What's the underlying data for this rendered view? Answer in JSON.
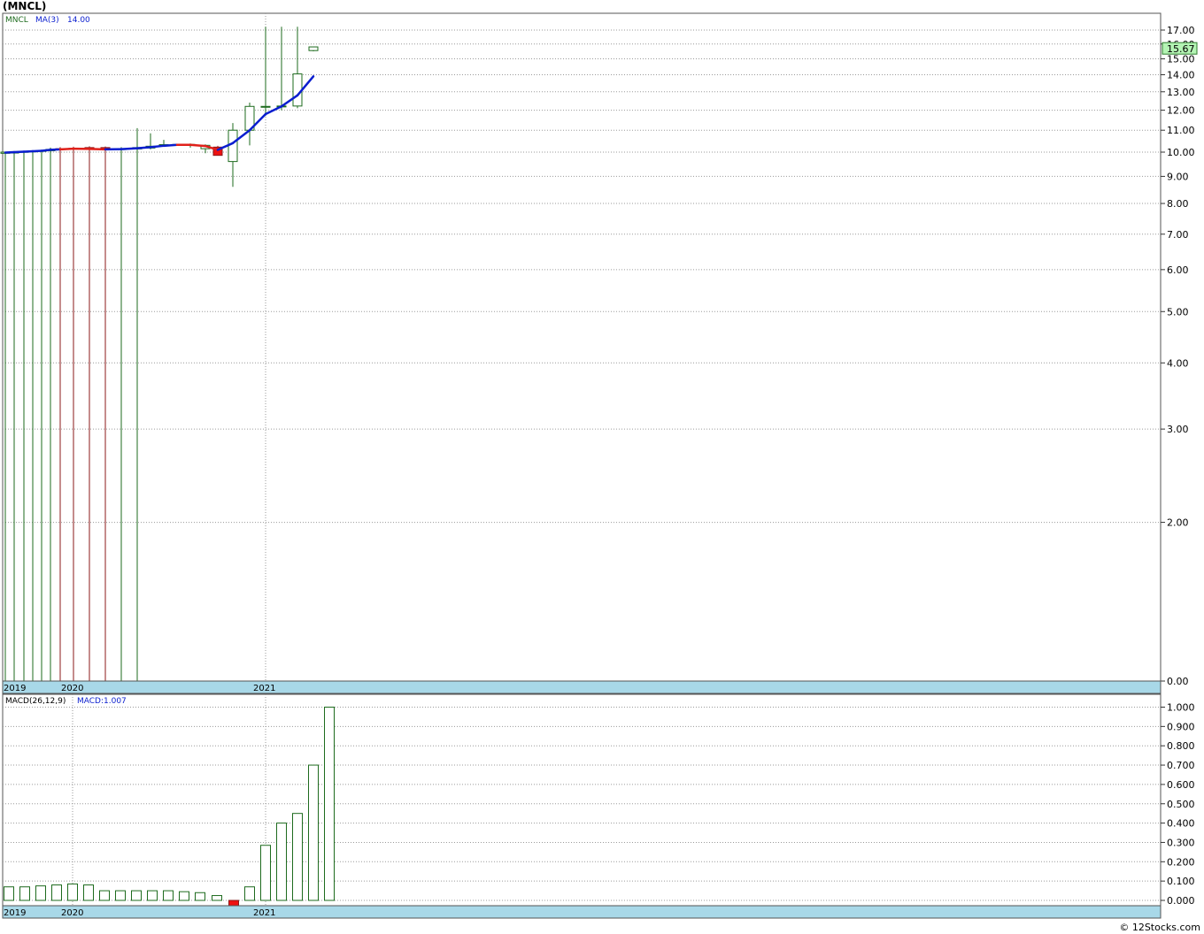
{
  "title": "(MNCL)",
  "footer": "© 12Stocks.com",
  "chart_data": {
    "type": "candlestick",
    "symbol": "MNCL",
    "ma_label": "MA(3)",
    "ma_value": "14.00",
    "last_price": "15.67",
    "price_axis": {
      "scale": "log",
      "ticks": [
        0.0,
        2.0,
        3.0,
        4.0,
        5.0,
        6.0,
        7.0,
        8.0,
        9.0,
        10.0,
        11.0,
        12.0,
        13.0,
        14.0,
        15.0,
        16.0,
        17.0
      ],
      "tick_labels": [
        "0.00",
        "2.00",
        "3.00",
        "4.00",
        "5.00",
        "6.00",
        "7.00",
        "8.00",
        "9.00",
        "10.00",
        "11.00",
        "12.00",
        "13.00",
        "14.00",
        "15.00",
        "16.00",
        "17.00"
      ]
    },
    "x_labels": [
      "2019",
      "2020",
      "2021"
    ],
    "candles": [
      {
        "open": 9.95,
        "high": 10.0,
        "low": 0.0,
        "close": 10.0,
        "color": "green"
      },
      {
        "open": 9.96,
        "high": 10.02,
        "low": 0.0,
        "close": 10.02,
        "color": "green"
      },
      {
        "open": 10.0,
        "high": 10.05,
        "low": 0.0,
        "close": 10.03,
        "color": "green"
      },
      {
        "open": 10.02,
        "high": 10.06,
        "low": 0.0,
        "close": 10.05,
        "color": "green"
      },
      {
        "open": 10.04,
        "high": 10.08,
        "low": 0.0,
        "close": 10.07,
        "color": "green"
      },
      {
        "open": 10.06,
        "high": 10.2,
        "low": 0.0,
        "close": 10.12,
        "color": "green"
      },
      {
        "open": 10.15,
        "high": 10.22,
        "low": 0.0,
        "close": 10.12,
        "color": "red"
      },
      {
        "open": 10.17,
        "high": 10.24,
        "low": 0.0,
        "close": 10.15,
        "color": "red"
      },
      {
        "open": 10.2,
        "high": 10.26,
        "low": 0.0,
        "close": 10.16,
        "color": "red"
      },
      {
        "open": 10.2,
        "high": 10.25,
        "low": 0.0,
        "close": 10.12,
        "color": "red"
      },
      {
        "open": 10.14,
        "high": 10.22,
        "low": 0.0,
        "close": 10.15,
        "color": "green"
      },
      {
        "open": 10.14,
        "high": 11.1,
        "low": 0.0,
        "close": 10.2,
        "color": "green"
      },
      {
        "open": 10.18,
        "high": 10.85,
        "low": 10.12,
        "close": 10.26,
        "color": "green"
      },
      {
        "open": 10.28,
        "high": 10.55,
        "low": 10.24,
        "close": 10.33,
        "color": "green"
      },
      {
        "open": 10.32,
        "high": 10.36,
        "low": 10.3,
        "close": 10.34,
        "color": "green"
      },
      {
        "open": 10.34,
        "high": 10.38,
        "low": 10.2,
        "close": 10.32,
        "color": "green"
      },
      {
        "open": 10.3,
        "high": 10.34,
        "low": 9.95,
        "close": 10.15,
        "color": "green"
      },
      {
        "open": 10.22,
        "high": 10.28,
        "low": 9.86,
        "close": 9.86,
        "color": "red"
      },
      {
        "open": 9.6,
        "high": 11.35,
        "low": 8.6,
        "close": 11.0,
        "color": "green"
      },
      {
        "open": 11.0,
        "high": 12.4,
        "low": 10.3,
        "close": 12.2,
        "color": "green"
      },
      {
        "open": 12.18,
        "high": 17.25,
        "low": 11.7,
        "close": 12.2,
        "color": "green"
      },
      {
        "open": 12.2,
        "high": 17.25,
        "low": 12.0,
        "close": 12.22,
        "color": "green"
      },
      {
        "open": 12.22,
        "high": 17.25,
        "low": 12.1,
        "close": 14.05,
        "color": "green"
      },
      {
        "open": 15.55,
        "high": 15.8,
        "low": 15.5,
        "close": 15.8,
        "color": "green"
      }
    ],
    "ma_line": [
      {
        "value": 9.98,
        "color": "blue"
      },
      {
        "value": 10.0,
        "color": "blue"
      },
      {
        "value": 10.02,
        "color": "blue"
      },
      {
        "value": 10.04,
        "color": "blue"
      },
      {
        "value": 10.06,
        "color": "blue"
      },
      {
        "value": 10.1,
        "color": "blue"
      },
      {
        "value": 10.12,
        "color": "blue"
      },
      {
        "value": 10.15,
        "color": "red"
      },
      {
        "value": 10.14,
        "color": "red"
      },
      {
        "value": 10.12,
        "color": "red"
      },
      {
        "value": 10.13,
        "color": "blue"
      },
      {
        "value": 10.17,
        "color": "blue"
      },
      {
        "value": 10.22,
        "color": "blue"
      },
      {
        "value": 10.28,
        "color": "blue"
      },
      {
        "value": 10.32,
        "color": "blue"
      },
      {
        "value": 10.32,
        "color": "red"
      },
      {
        "value": 10.27,
        "color": "red"
      },
      {
        "value": 10.1,
        "color": "red"
      },
      {
        "value": 10.4,
        "color": "blue"
      },
      {
        "value": 11.0,
        "color": "blue"
      },
      {
        "value": 11.8,
        "color": "blue"
      },
      {
        "value": 12.2,
        "color": "blue"
      },
      {
        "value": 12.8,
        "color": "blue"
      },
      {
        "value": 13.9,
        "color": "blue"
      }
    ],
    "macd": {
      "label": "MACD(26,12,9)",
      "value_label": "MACD:1.007",
      "axis_ticks": [
        0.0,
        0.1,
        0.2,
        0.3,
        0.4,
        0.5,
        0.6,
        0.7,
        0.8,
        0.9,
        1.0
      ],
      "axis_labels": [
        "0.000",
        "0.100",
        "0.200",
        "0.300",
        "0.400",
        "0.500",
        "0.600",
        "0.700",
        "0.800",
        "0.900",
        "1.000"
      ],
      "bars": [
        {
          "value": 0.07,
          "color": "green"
        },
        {
          "value": 0.07,
          "color": "green"
        },
        {
          "value": 0.075,
          "color": "green"
        },
        {
          "value": 0.08,
          "color": "green"
        },
        {
          "value": 0.085,
          "color": "green"
        },
        {
          "value": 0.08,
          "color": "green"
        },
        {
          "value": 0.05,
          "color": "green"
        },
        {
          "value": 0.05,
          "color": "green"
        },
        {
          "value": 0.05,
          "color": "green"
        },
        {
          "value": 0.05,
          "color": "green"
        },
        {
          "value": 0.05,
          "color": "green"
        },
        {
          "value": 0.045,
          "color": "green"
        },
        {
          "value": 0.04,
          "color": "green"
        },
        {
          "value": 0.025,
          "color": "green"
        },
        {
          "value": -0.035,
          "color": "red"
        },
        {
          "value": 0.07,
          "color": "green"
        },
        {
          "value": 0.285,
          "color": "green"
        },
        {
          "value": 0.4,
          "color": "green"
        },
        {
          "value": 0.45,
          "color": "green"
        },
        {
          "value": 0.7,
          "color": "green"
        },
        {
          "value": 1.0,
          "color": "green"
        }
      ]
    }
  }
}
